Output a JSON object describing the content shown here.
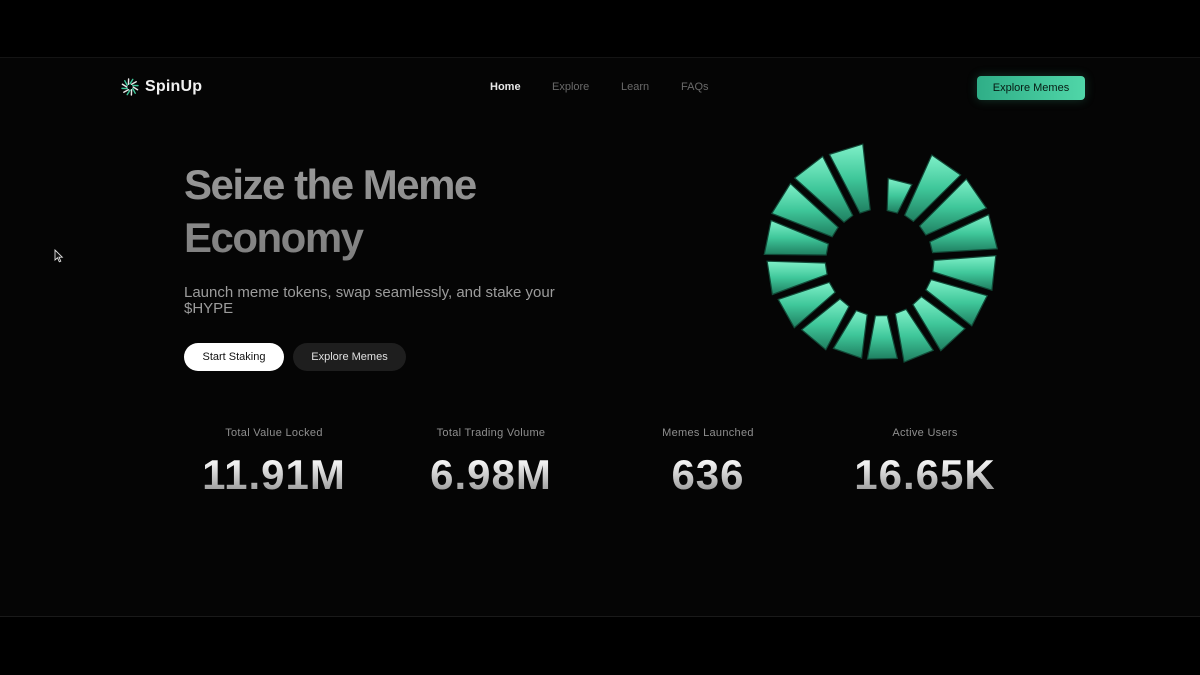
{
  "brand": {
    "name": "SpinUp",
    "icon": "spin-logo-icon"
  },
  "nav": {
    "items": [
      {
        "label": "Home",
        "active": true
      },
      {
        "label": "Explore",
        "active": false
      },
      {
        "label": "Learn",
        "active": false
      },
      {
        "label": "FAQs",
        "active": false
      }
    ],
    "cta_label": "Explore Memes"
  },
  "hero": {
    "title_line1": "Seize the Meme",
    "title_line2": "Economy",
    "subtitle": "Launch meme tokens, swap seamlessly, and stake your $HYPE",
    "primary_button": "Start Staking",
    "secondary_button": "Explore Memes",
    "art": "spiral-blocks-graphic"
  },
  "stats": [
    {
      "label": "Total Value Locked",
      "value": "11.91M"
    },
    {
      "label": "Total Trading Volume",
      "value": "6.98M"
    },
    {
      "label": "Memes Launched",
      "value": "636"
    },
    {
      "label": "Active Users",
      "value": "16.65K"
    }
  ],
  "colors": {
    "accent": "#3fc79a",
    "accent_dark": "#2fae87",
    "background": "#050505",
    "muted_text": "#8f8f8f"
  }
}
